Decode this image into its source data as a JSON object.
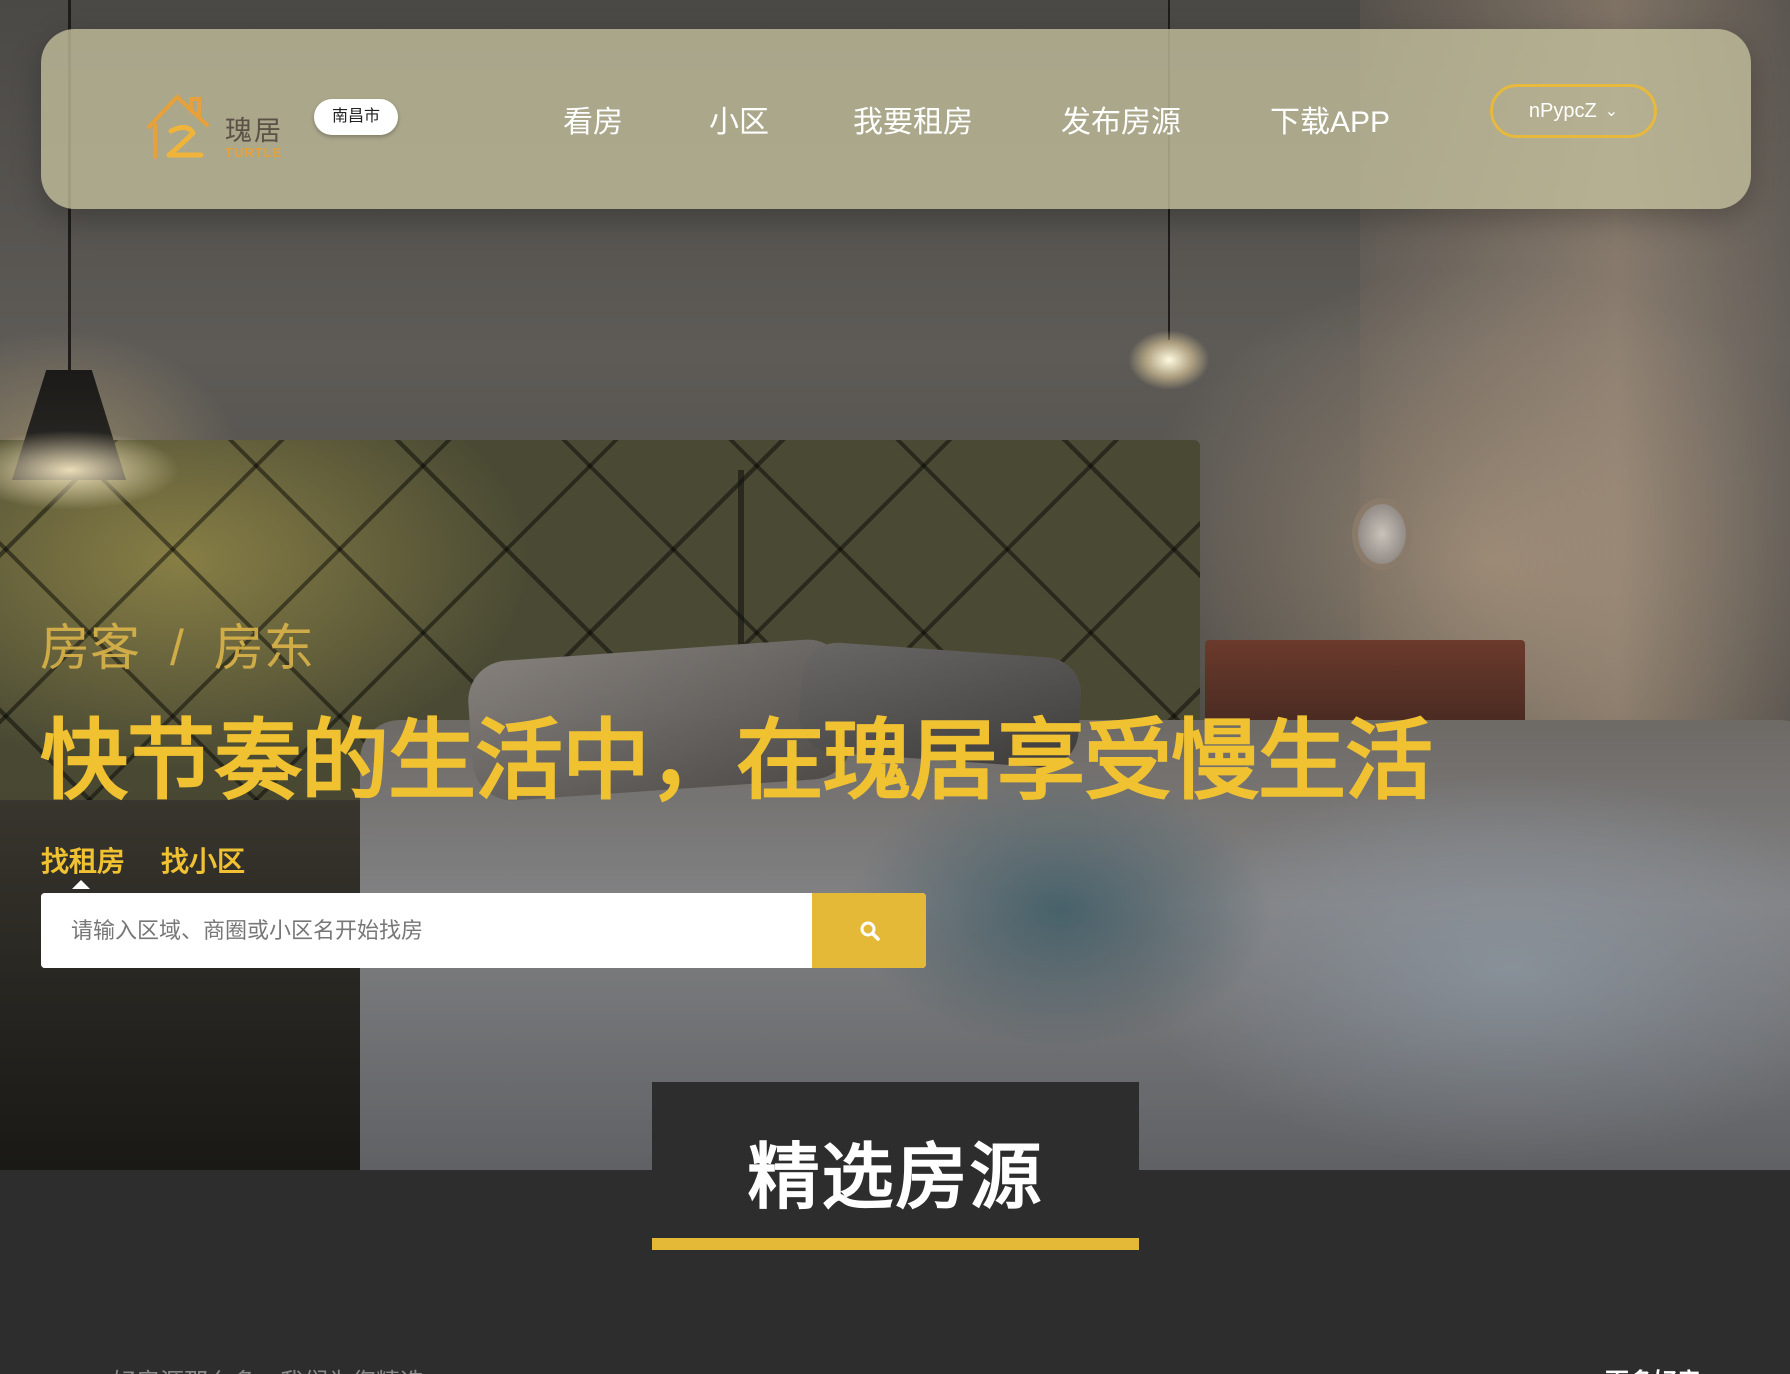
{
  "header": {
    "logo": {
      "name": "瑰居",
      "sub": "TURTLE"
    },
    "city": "南昌市",
    "nav": [
      {
        "label": "看房"
      },
      {
        "label": "小区"
      },
      {
        "label": "我要租房"
      },
      {
        "label": "发布房源"
      },
      {
        "label": "下载APP"
      }
    ],
    "user": {
      "name": "nPypcZ",
      "icon": "chevron-down-icon"
    }
  },
  "hero": {
    "roles": [
      "房客",
      "房东"
    ],
    "role_separator": "/",
    "slogan": "快节奏的生活中，在瑰居享受慢生活",
    "search_tabs": [
      {
        "label": "找租房",
        "active": true
      },
      {
        "label": "找小区",
        "active": false
      }
    ],
    "search": {
      "placeholder": "请输入区域、商圈或小区名开始找房",
      "value": "",
      "button_icon": "search-icon"
    }
  },
  "featured": {
    "title": "精选房源",
    "subtitle": "好房源那么多，我们为您精选",
    "more": "更多好房"
  },
  "colors": {
    "accent": "#e5b938",
    "slogan": "#f0c232",
    "dark_bg": "#2e2d2d"
  }
}
